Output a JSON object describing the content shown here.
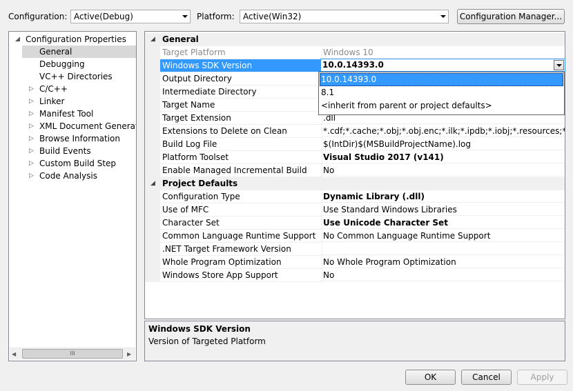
{
  "top_bar": {
    "configuration_label": "Configuration:",
    "configuration_value": "Active(Debug)",
    "platform_label": "Platform:",
    "platform_value": "Active(Win32)",
    "config_manager_label": "Configuration Manager..."
  },
  "tree": {
    "items": [
      {
        "label": "Configuration Properties",
        "expander": "◢"
      },
      {
        "label": "General",
        "expander": ""
      },
      {
        "label": "Debugging",
        "expander": ""
      },
      {
        "label": "VC++ Directories",
        "expander": ""
      },
      {
        "label": "C/C++",
        "expander": "▷"
      },
      {
        "label": "Linker",
        "expander": "▷"
      },
      {
        "label": "Manifest Tool",
        "expander": "▷"
      },
      {
        "label": "XML Document Generator",
        "expander": "▷"
      },
      {
        "label": "Browse Information",
        "expander": "▷"
      },
      {
        "label": "Build Events",
        "expander": "▷"
      },
      {
        "label": "Custom Build Step",
        "expander": "▷"
      },
      {
        "label": "Code Analysis",
        "expander": "▷"
      }
    ],
    "scroll_grip": "III",
    "scroll_left_arrow": "◀",
    "scroll_right_arrow": "▶"
  },
  "grid": {
    "category_expander": "◢",
    "general": {
      "title": "General",
      "rows": [
        {
          "name": "Target Platform",
          "value": "Windows 10"
        },
        {
          "name": "Windows SDK Version",
          "value": "10.0.14393.0"
        },
        {
          "name": "Output Directory",
          "value": ""
        },
        {
          "name": "Intermediate Directory",
          "value": ""
        },
        {
          "name": "Target Name",
          "value": ""
        },
        {
          "name": "Target Extension",
          "value": ".dll"
        },
        {
          "name": "Extensions to Delete on Clean",
          "value": "*.cdf;*.cache;*.obj;*.obj.enc;*.ilk;*.ipdb;*.iobj;*.resources;*.tlb;*.tli;*."
        },
        {
          "name": "Build Log File",
          "value": "$(IntDir)$(MSBuildProjectName).log"
        },
        {
          "name": "Platform Toolset",
          "value": "Visual Studio 2017 (v141)"
        },
        {
          "name": "Enable Managed Incremental Build",
          "value": "No"
        }
      ]
    },
    "project_defaults": {
      "title": "Project Defaults",
      "rows": [
        {
          "name": "Configuration Type",
          "value": "Dynamic Library (.dll)"
        },
        {
          "name": "Use of MFC",
          "value": "Use Standard Windows Libraries"
        },
        {
          "name": "Character Set",
          "value": "Use Unicode Character Set"
        },
        {
          "name": "Common Language Runtime Support",
          "value": "No Common Language Runtime Support"
        },
        {
          "name": ".NET Target Framework Version",
          "value": ""
        },
        {
          "name": "Whole Program Optimization",
          "value": "No Whole Program Optimization"
        },
        {
          "name": "Windows Store App Support",
          "value": "No"
        }
      ]
    },
    "sdk_dropdown_options": [
      "10.0.14393.0",
      "8.1",
      "<inherit from parent or project defaults>"
    ]
  },
  "description": {
    "title": "Windows SDK Version",
    "text": "Version of Targeted Platform"
  },
  "buttons": {
    "ok": "OK",
    "cancel": "Cancel",
    "apply": "Apply"
  }
}
